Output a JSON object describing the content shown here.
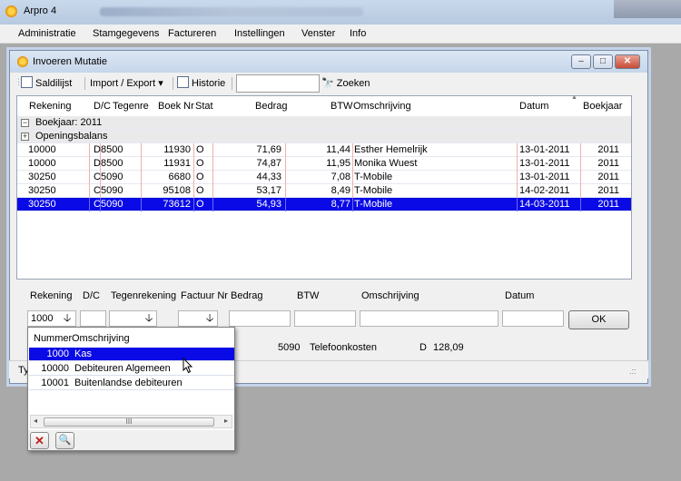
{
  "app": {
    "title": "Arpro 4"
  },
  "menu": [
    "Administratie",
    "Stamgegevens",
    "Factureren",
    "Instellingen",
    "Venster",
    "Info"
  ],
  "child": {
    "title": "Invoeren Mutatie",
    "caption": {
      "minimize": "–",
      "maximize": "□",
      "close": "✕"
    }
  },
  "toolbar": {
    "saldilijst": "Saldilijst",
    "import_export": "Import / Export",
    "dropdown_glyph": "▾",
    "historie": "Historie",
    "search_value": "",
    "zoeken": "Zoeken"
  },
  "grid": {
    "columns": [
      "Rekening",
      "D/C",
      "Tegenre",
      "Boek Nr",
      "Stat",
      "Bedrag",
      "BTW",
      "Omschrijving",
      "Datum",
      "Boekjaar"
    ],
    "sort_glyph": "▲",
    "groups": [
      {
        "expander": "−",
        "label": "Boekjaar: 2011"
      },
      {
        "expander": "+",
        "label": "Openingsbalans"
      }
    ],
    "rows": [
      {
        "rekening": "10000",
        "dc": "D",
        "tegenre": "8500",
        "boeknr": "11930",
        "stat": "O",
        "bedrag": "71,69",
        "btw": "11,44",
        "omschrijving": "Esther Hemelrijk",
        "datum": "13-01-2011",
        "boekjaar": "2011"
      },
      {
        "rekening": "10000",
        "dc": "D",
        "tegenre": "8500",
        "boeknr": "11931",
        "stat": "O",
        "bedrag": "74,87",
        "btw": "11,95",
        "omschrijving": "Monika Wuest",
        "datum": "13-01-2011",
        "boekjaar": "2011"
      },
      {
        "rekening": "30250",
        "dc": "C",
        "tegenre": "5090",
        "boeknr": "6680",
        "stat": "O",
        "bedrag": "44,33",
        "btw": "7,08",
        "omschrijving": "T-Mobile",
        "datum": "13-01-2011",
        "boekjaar": "2011"
      },
      {
        "rekening": "30250",
        "dc": "C",
        "tegenre": "5090",
        "boeknr": "95108",
        "stat": "O",
        "bedrag": "53,17",
        "btw": "8,49",
        "omschrijving": "T-Mobile",
        "datum": "14-02-2011",
        "boekjaar": "2011"
      },
      {
        "rekening": "30250",
        "dc": "C",
        "tegenre": "5090",
        "boeknr": "73612",
        "stat": "O",
        "bedrag": "54,93",
        "btw": "8,77",
        "omschrijving": "T-Mobile",
        "datum": "14-03-2011",
        "boekjaar": "2011"
      }
    ],
    "selected_row": 4
  },
  "entry": {
    "labels": {
      "rekening": "Rekening",
      "dc": "D/C",
      "tegenrekening": "Tegenrekening",
      "factuur": "Factuur Nr",
      "bedrag": "Bedrag",
      "btw": "BTW",
      "omschrijving": "Omschrijving",
      "datum": "Datum"
    },
    "rekening_value": "1000",
    "dropdown_glyph": "🡣",
    "ok": "OK"
  },
  "info": {
    "tegenrekening": "5090",
    "omschrijving": "Telefoonkosten",
    "dc": "D",
    "bedrag": "128,09"
  },
  "status": {
    "text": "Ty",
    "grip": ".::"
  },
  "popup": {
    "headers": {
      "nummer": "Nummer",
      "omschrijving": "Omschrijving"
    },
    "rows": [
      {
        "nummer": "1000",
        "omschrijving": "Kas"
      },
      {
        "nummer": "10000",
        "omschrijving": "Debiteuren Algemeen"
      },
      {
        "nummer": "10001",
        "omschrijving": "Buitenlandse debiteuren"
      }
    ],
    "selected_row": 0,
    "scroll": {
      "left": "◂",
      "right": "▸",
      "thumb": "III"
    },
    "buttons": {
      "delete": "✕",
      "search": "🔍"
    }
  },
  "colors": {
    "selection": "#0a0ae6",
    "window_frame": "#c3d3e8",
    "mdi_background": "#a9a9a9"
  }
}
